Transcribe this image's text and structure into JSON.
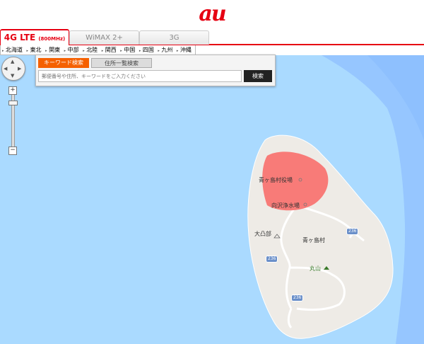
{
  "header": {
    "logo": "au",
    "logo_color": "#e60012"
  },
  "tabs": [
    {
      "label": "4G LTE",
      "sub": "(800MHz)",
      "active": true
    },
    {
      "label": "WiMAX 2+",
      "active": false
    },
    {
      "label": "3G",
      "active": false
    }
  ],
  "regions": [
    "北海道",
    "東北",
    "関東",
    "中部",
    "北陸",
    "関西",
    "中国",
    "四国",
    "九州",
    "沖縄"
  ],
  "search": {
    "tab_keyword": "キーワード検索",
    "tab_address": "住所一覧検索",
    "placeholder": "郵便番号や住所、キーワードをご入力ください",
    "button": "検索"
  },
  "map": {
    "labels": {
      "village_office": "青ヶ島村役場",
      "water_plant": "向沢浄水場",
      "peak1": "大凸部",
      "village": "青ヶ島村",
      "peak2": "丸山"
    },
    "route": "236",
    "coverage_color": "#f86f6c",
    "sea_color": "#aadaff"
  },
  "controls": {
    "zoom_in": "+",
    "zoom_out": "−"
  }
}
